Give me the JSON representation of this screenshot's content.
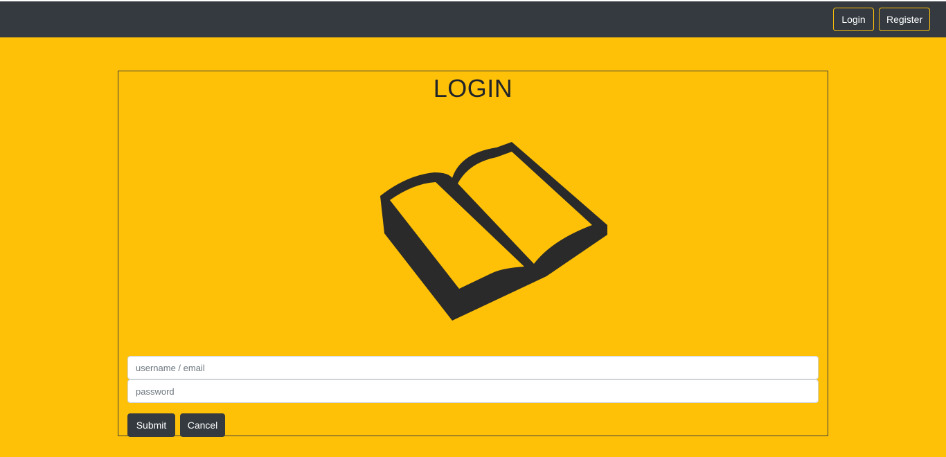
{
  "navbar": {
    "login_label": "Login",
    "register_label": "Register"
  },
  "login_form": {
    "title": "LOGIN",
    "username_placeholder": "username / email",
    "username_value": "",
    "password_placeholder": "password",
    "password_value": "",
    "submit_label": "Submit",
    "cancel_label": "Cancel",
    "illustration_icon": "open-book-icon"
  },
  "colors": {
    "background": "#ffc107",
    "navbar": "#343a40",
    "nav_button_border": "#ffc107",
    "button": "#343a40",
    "icon": "#2a2a2a"
  }
}
